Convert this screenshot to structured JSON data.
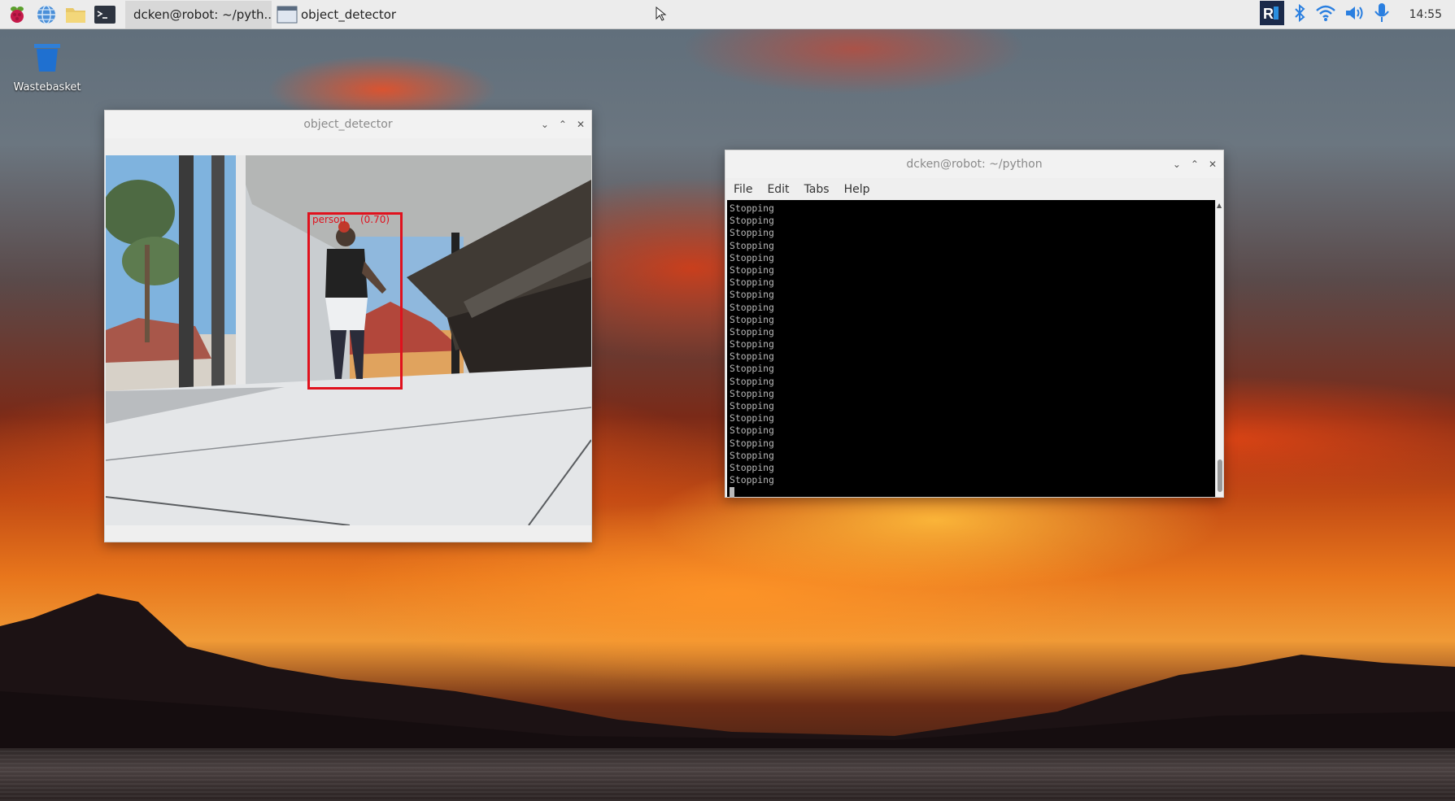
{
  "taskbar": {
    "tasks": [
      {
        "label": "dcken@robot: ~/pyth..."
      },
      {
        "label": "object_detector"
      }
    ],
    "clock": "14:55"
  },
  "desktop": {
    "icons": [
      {
        "label": "Wastebasket"
      }
    ]
  },
  "detector_window": {
    "title": "object_detector",
    "detection": {
      "label": "person",
      "score": "(0.70)",
      "box_color": "#e0111d"
    }
  },
  "terminal_window": {
    "title": "dcken@robot: ~/python",
    "menu": [
      "File",
      "Edit",
      "Tabs",
      "Help"
    ],
    "lines": [
      "Stopping",
      "Stopping",
      "Stopping",
      "Stopping",
      "Stopping",
      "Stopping",
      "Stopping",
      "Stopping",
      "Stopping",
      "Stopping",
      "Stopping",
      "Stopping",
      "Stopping",
      "Stopping",
      "Stopping",
      "Stopping",
      "Stopping",
      "Stopping",
      "Stopping",
      "Stopping",
      "Stopping",
      "Stopping",
      "Stopping"
    ]
  },
  "colors": {
    "taskbar_bg": "#ececec",
    "terminal_bg": "#000000",
    "terminal_fg": "#b8b8b8",
    "detection_box": "#e0111d"
  }
}
